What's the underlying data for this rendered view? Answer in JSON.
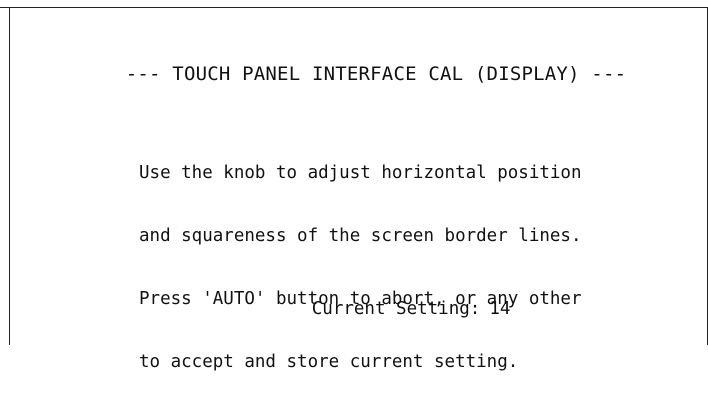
{
  "screen": {
    "title": "--- TOUCH PANEL INTERFACE CAL (DISPLAY) ---",
    "instructions": [
      "Use the knob to adjust horizontal position",
      "and squareness of the screen border lines.",
      "Press 'AUTO' button to abort, or any other",
      "to accept and store current setting."
    ],
    "current_setting_label": "Current Setting:",
    "current_setting_value": "14"
  },
  "colors": {
    "background": "#ffffff",
    "text": "#111111",
    "border": "#222222"
  }
}
